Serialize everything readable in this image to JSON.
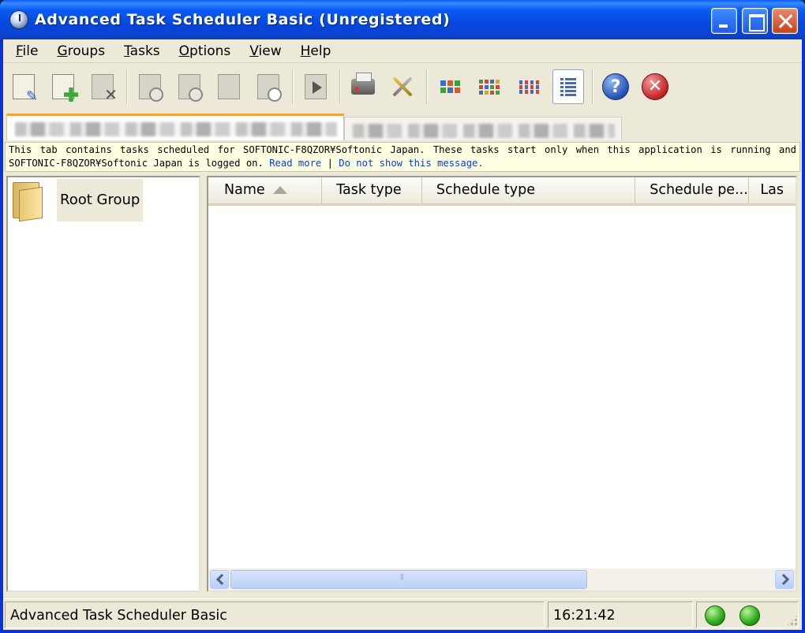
{
  "window": {
    "title": "Advanced Task Scheduler Basic (Unregistered)"
  },
  "menu": [
    {
      "label": "File",
      "mnemonic": "F",
      "rest": "ile"
    },
    {
      "label": "Groups",
      "mnemonic": "G",
      "rest": "roups"
    },
    {
      "label": "Tasks",
      "mnemonic": "T",
      "rest": "asks"
    },
    {
      "label": "Options",
      "mnemonic": "O",
      "rest": "ptions"
    },
    {
      "label": "View",
      "mnemonic": "V",
      "rest": "iew"
    },
    {
      "label": "Help",
      "mnemonic": "H",
      "rest": "elp"
    }
  ],
  "toolbar": {
    "icons": [
      "new-task-icon",
      "copy-task-icon",
      "delete-task-icon",
      "task-properties-icon",
      "task-schedule-icon",
      "task-export-icon",
      "task-preview-icon",
      "run-task-icon",
      "printer-icon",
      "tools-icon",
      "large-icons-view-icon",
      "small-icons-view-icon",
      "list-view-icon",
      "details-view-icon",
      "help-icon",
      "exit-icon"
    ],
    "active_view": "details"
  },
  "tabs": [
    {
      "label": "▓▓▓▓▓▓▓▓▓▓▓▓▓▓▓▓▓▓▓▓▓▓▓▓▓▓▓▓",
      "active": true
    },
    {
      "label": "▓▓▓▓▓▓▓▓▓▓▓▓▓▓▓▓▓▓▓▓▓▓▓▓",
      "active": false
    }
  ],
  "info": {
    "text": "This tab contains tasks scheduled for SOFTONIC-F8QZOR¥Softonic Japan. These tasks start only when this application is running and SOFTONIC-F8QZOR¥Softonic Japan is logged on.",
    "read_more": "Read more",
    "separator": "|",
    "dismiss": "Do not show this message."
  },
  "tree": {
    "root_label": "Root Group"
  },
  "list": {
    "columns": [
      "Name",
      "Task type",
      "Schedule type",
      "Schedule pe...",
      "Las"
    ],
    "sort_column": "Name",
    "sort_direction": "ascending",
    "rows": []
  },
  "status": {
    "text": "Advanced Task Scheduler Basic",
    "time": "16:21:42",
    "led_color": "#2fa81c"
  }
}
